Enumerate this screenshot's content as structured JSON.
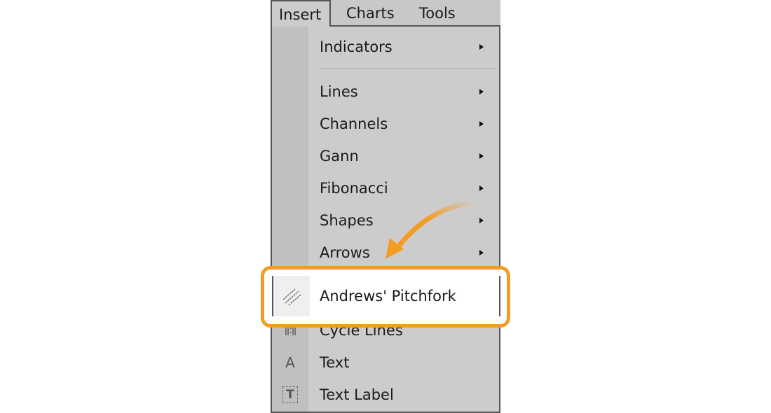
{
  "menubar": {
    "items": [
      "Insert",
      "Charts",
      "Tools"
    ]
  },
  "menu": {
    "items": [
      {
        "label": "Indicators",
        "submenu": true
      },
      {
        "label": "Lines",
        "submenu": true
      },
      {
        "label": "Channels",
        "submenu": true
      },
      {
        "label": "Gann",
        "submenu": true
      },
      {
        "label": "Fibonacci",
        "submenu": true
      },
      {
        "label": "Shapes",
        "submenu": true
      },
      {
        "label": "Arrows",
        "submenu": true
      },
      {
        "label": "Andrews' Pitchfork",
        "icon": "pitchfork-icon",
        "highlighted": true
      },
      {
        "label": "Cycle Lines",
        "icon": "cycle-lines-icon"
      },
      {
        "label": "Text",
        "icon": "text-icon"
      },
      {
        "label": "Text Label",
        "icon": "text-label-icon"
      }
    ]
  },
  "annotation": {
    "color": "#f39c25"
  }
}
